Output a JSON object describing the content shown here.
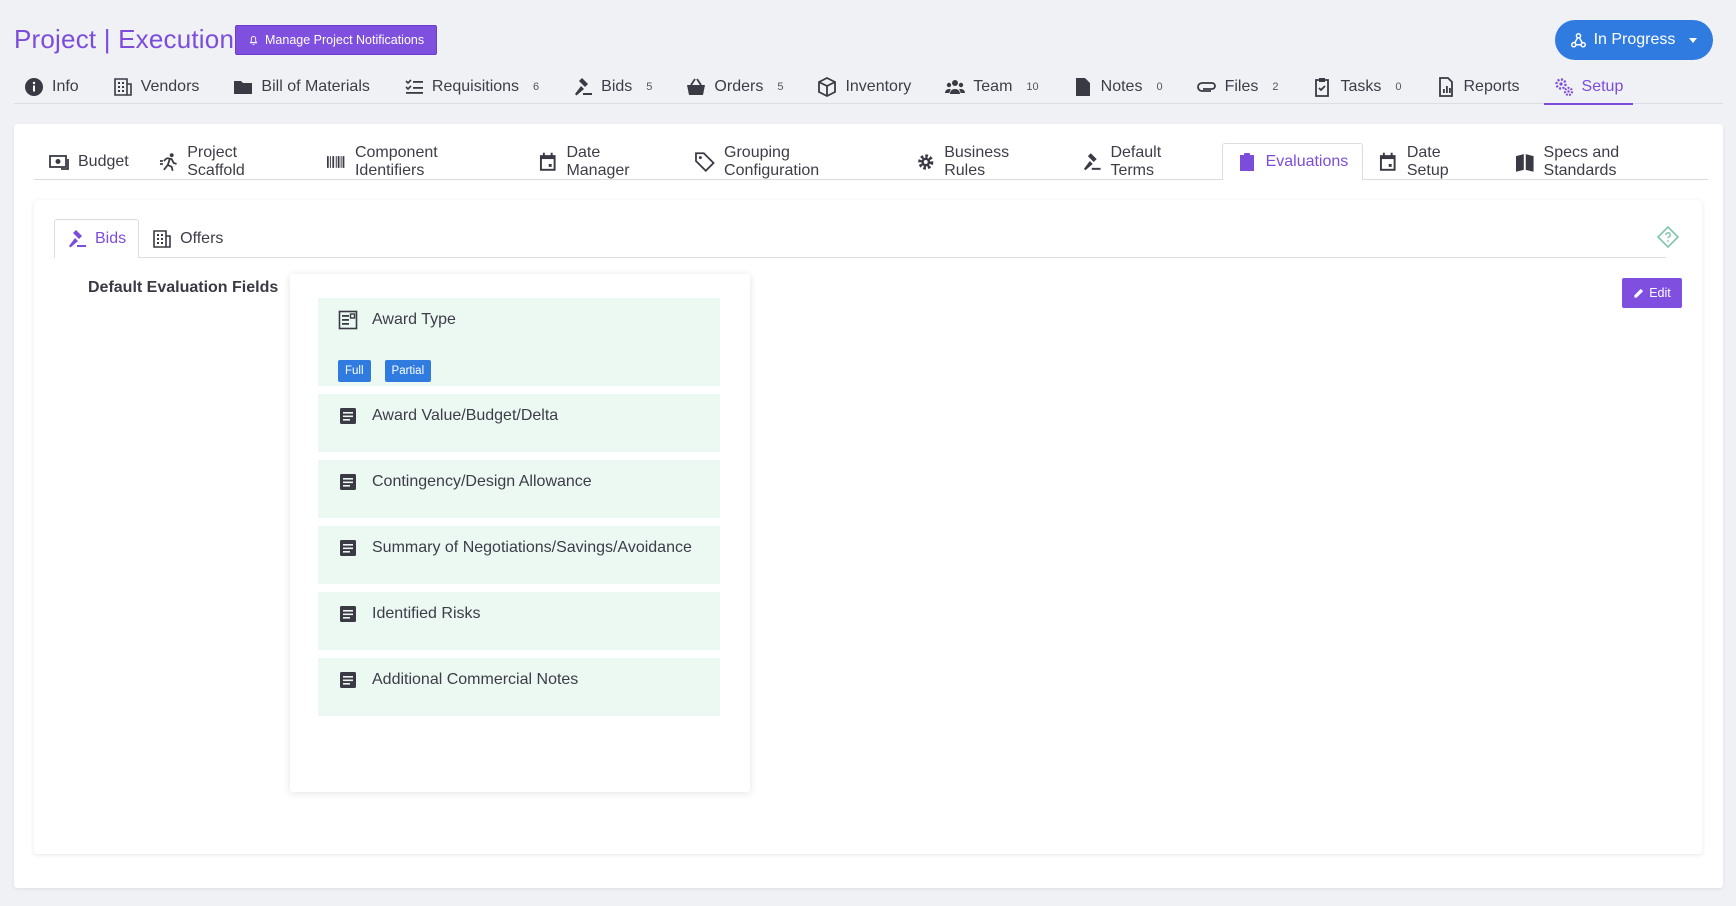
{
  "header": {
    "title": "Project | Execution",
    "notifications_button": "Manage Project Notifications",
    "status": "In Progress"
  },
  "main_nav": [
    {
      "label": "Info",
      "icon": "info-icon",
      "count": null
    },
    {
      "label": "Vendors",
      "icon": "building-icon",
      "count": null
    },
    {
      "label": "Bill of Materials",
      "icon": "folder-icon",
      "count": null
    },
    {
      "label": "Requisitions",
      "icon": "checklist-icon",
      "count": "6"
    },
    {
      "label": "Bids",
      "icon": "gavel-icon",
      "count": "5"
    },
    {
      "label": "Orders",
      "icon": "basket-icon",
      "count": "5"
    },
    {
      "label": "Inventory",
      "icon": "box-icon",
      "count": null
    },
    {
      "label": "Team",
      "icon": "users-icon",
      "count": "10"
    },
    {
      "label": "Notes",
      "icon": "note-icon",
      "count": "0"
    },
    {
      "label": "Files",
      "icon": "paperclip-icon",
      "count": "2"
    },
    {
      "label": "Tasks",
      "icon": "clipboard-check-icon",
      "count": "0"
    },
    {
      "label": "Reports",
      "icon": "report-icon",
      "count": null
    },
    {
      "label": "Setup",
      "icon": "gears-icon",
      "count": null,
      "active": true
    }
  ],
  "setup_nav": [
    {
      "label": "Budget",
      "icon": "money-icon"
    },
    {
      "label": "Project Scaffold",
      "icon": "runner-icon"
    },
    {
      "label": "Component Identifiers",
      "icon": "barcode-icon"
    },
    {
      "label": "Date Manager",
      "icon": "calendar-icon"
    },
    {
      "label": "Grouping Configuration",
      "icon": "tag-icon"
    },
    {
      "label": "Business Rules",
      "icon": "gear-icon"
    },
    {
      "label": "Default Terms",
      "icon": "gavel-icon"
    },
    {
      "label": "Evaluations",
      "icon": "clipboard-icon",
      "active": true
    },
    {
      "label": "Date Setup",
      "icon": "calendar-icon"
    },
    {
      "label": "Specs and Standards",
      "icon": "book-icon"
    }
  ],
  "evaluation_tabs": [
    {
      "label": "Bids",
      "icon": "gavel-icon",
      "active": true
    },
    {
      "label": "Offers",
      "icon": "building-icon"
    }
  ],
  "section": {
    "label": "Default Evaluation Fields",
    "edit_button": "Edit"
  },
  "fields": [
    {
      "label": "Award Type",
      "icon": "form-icon",
      "options": [
        "Full",
        "Partial"
      ]
    },
    {
      "label": "Award Value/Budget/Delta",
      "icon": "document-icon"
    },
    {
      "label": "Contingency/Design Allowance",
      "icon": "document-icon"
    },
    {
      "label": "Summary of Negotiations/Savings/Avoidance",
      "icon": "document-icon"
    },
    {
      "label": "Identified Risks",
      "icon": "document-icon"
    },
    {
      "label": "Additional Commercial Notes",
      "icon": "document-icon"
    }
  ],
  "colors": {
    "accent": "#7c4ddb",
    "status_blue": "#2f7be0",
    "field_bg": "#ecf8f2"
  }
}
